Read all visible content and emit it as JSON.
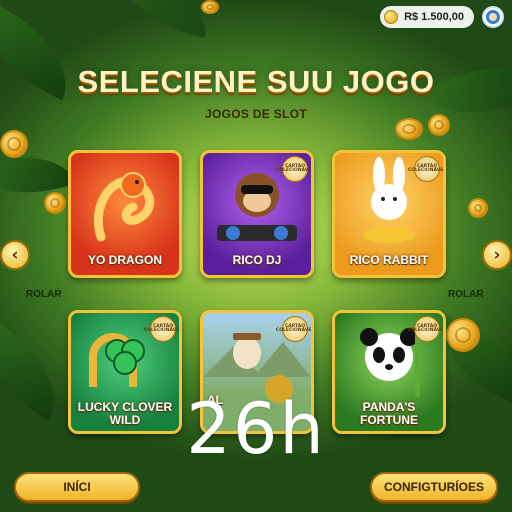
{
  "header": {
    "balance": "R$ 1.500,00",
    "title": "SELECIENE SUU JOGO",
    "subtitle": "JOGOS DE SLOT"
  },
  "cards": [
    {
      "name": "YO DRAGON",
      "badge": "",
      "bg": "#e2431f"
    },
    {
      "name": "RICO DJ",
      "badge": "CARTÃO COLECIONÁVEL",
      "bg": "#7a2fc0"
    },
    {
      "name": "RICO RABBIT",
      "badge": "CARTÃO COLECIONÁVEL",
      "bg": "#f0a424"
    },
    {
      "name": "LUCKY CLOVER WILD",
      "badge": "CARTÃO COLECIONÁVEL",
      "bg": "#1f9a52"
    },
    {
      "name": "AL",
      "badge": "CARTÃO COLECIONÁVEL",
      "bg": "#8fbadc"
    },
    {
      "name": "PANDA'S FORTUNE",
      "badge": "CARTÃO COLECIONÁVEL",
      "bg": "#3f8a2a"
    }
  ],
  "navigation": {
    "left_arrow": "‹",
    "right_arrow": "›",
    "left_label": "ROLAR",
    "right_label": "ROLAR"
  },
  "overlay": {
    "timer": "26h"
  },
  "buttons": {
    "start": "INÍCI",
    "settings": "CONFIGTURÍOES"
  },
  "colors": {
    "gold": "#f4c33a",
    "text_dark": "#3a2600"
  }
}
